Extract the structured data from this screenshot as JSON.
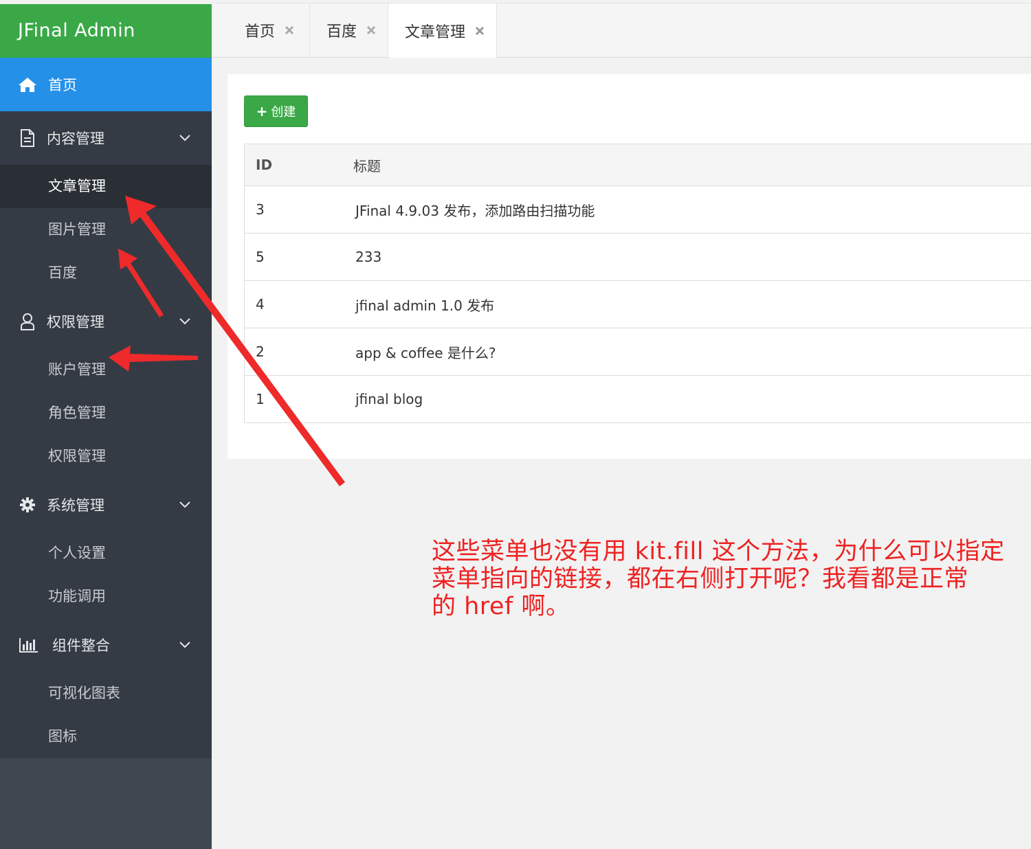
{
  "app": {
    "title": "JFinal Admin"
  },
  "sidebar": {
    "home": {
      "label": "首页",
      "icon": "home-icon"
    },
    "groups": [
      {
        "label": "内容管理",
        "icon": "document-icon",
        "items": [
          {
            "label": "文章管理",
            "active": true
          },
          {
            "label": "图片管理"
          },
          {
            "label": "百度"
          }
        ]
      },
      {
        "label": "权限管理",
        "icon": "user-icon",
        "items": [
          {
            "label": "账户管理"
          },
          {
            "label": "角色管理"
          },
          {
            "label": "权限管理"
          }
        ]
      },
      {
        "label": "系统管理",
        "icon": "gear-icon",
        "items": [
          {
            "label": "个人设置"
          },
          {
            "label": "功能调用"
          }
        ]
      },
      {
        "label": "组件整合",
        "icon": "bar-chart-icon",
        "items": [
          {
            "label": "可视化图表"
          },
          {
            "label": "图标"
          }
        ]
      }
    ]
  },
  "tabs": [
    {
      "label": "首页"
    },
    {
      "label": "百度"
    },
    {
      "label": "文章管理",
      "active": true
    }
  ],
  "toolbar": {
    "create_label": "创建"
  },
  "table": {
    "columns": [
      "ID",
      "标题"
    ],
    "rows": [
      {
        "id": "3",
        "title": "JFinal 4.9.03 发布，添加路由扫描功能"
      },
      {
        "id": "5",
        "title": "233"
      },
      {
        "id": "4",
        "title": "jfinal admin 1.0 发布"
      },
      {
        "id": "2",
        "title": "app & coffee 是什么?"
      },
      {
        "id": "1",
        "title": "jfinal blog"
      }
    ]
  },
  "annotation": {
    "lines": [
      "这些菜单也没有用 kit.fill 这个方法，为什么可以指定",
      "菜单指向的链接，都在右侧打开呢？我看都是正常",
      "的 href 啊。"
    ],
    "color": "#ee2222"
  },
  "colors": {
    "brand": "#3aa847",
    "active": "#2590e8",
    "sidebar": "#353b44"
  }
}
